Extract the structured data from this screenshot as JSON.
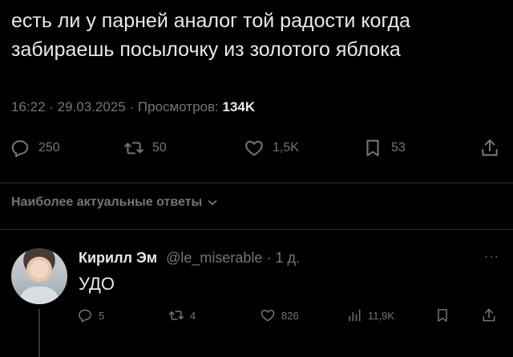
{
  "tweet": {
    "text_line1": "есть ли у парней аналог той радости когда",
    "text_line2": "забираешь посылочку из золотого яблока",
    "time": "16:22",
    "date": "29.03.2025",
    "views_label": "Просмотров:",
    "views_count": "134K",
    "actions": {
      "replies": "250",
      "reposts": "50",
      "likes": "1,5K",
      "bookmarks": "53"
    }
  },
  "replies_section": {
    "sort_label": "Наиболее актуальные ответы"
  },
  "reply": {
    "name": "Кирилл Эм",
    "handle": "@le_miserable",
    "age": "1 д.",
    "text": "УДО",
    "actions": {
      "replies": "5",
      "reposts": "4",
      "likes": "826",
      "views": "11,9K"
    }
  },
  "icons": [
    "reply-icon",
    "repost-icon",
    "like-icon",
    "bookmark-icon",
    "share-icon",
    "views-icon",
    "chevron-down-icon",
    "more-icon"
  ],
  "colors": {
    "background": "#000000",
    "text": "#e7e9ea",
    "muted": "#71767b"
  }
}
